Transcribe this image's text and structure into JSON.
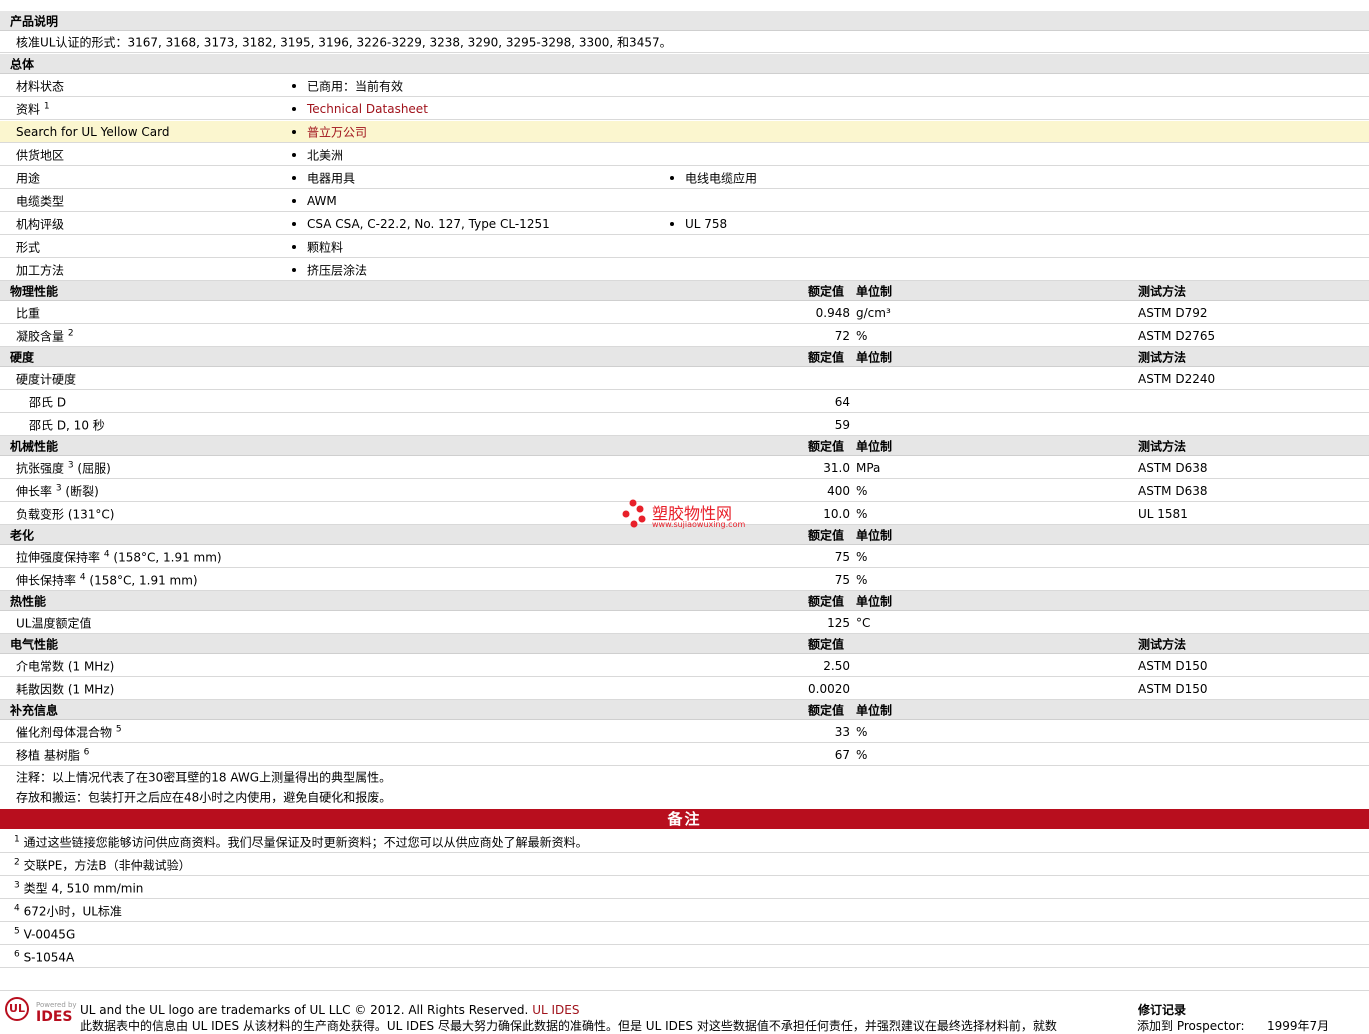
{
  "description": {
    "section": "产品说明",
    "text": "核准UL认证的形式：3167, 3168, 3173, 3182, 3195, 3196, 3226-3229, 3238, 3290, 3295-3298, 3300, 和3457。"
  },
  "general": {
    "section": "总体",
    "rows": [
      {
        "label": "材料状态",
        "sup": "",
        "values": [
          "已商用：当前有效"
        ]
      },
      {
        "label": "资料",
        "sup": "1",
        "values": [
          "Technical Datasheet"
        ]
      },
      {
        "label": "Search for UL Yellow Card",
        "sup": "",
        "values": [
          "普立万公司"
        ]
      },
      {
        "label": "供货地区",
        "sup": "",
        "values": [
          "北美洲"
        ]
      },
      {
        "label": "用途",
        "sup": "",
        "values": [
          "电器用具",
          "电线电缆应用"
        ]
      },
      {
        "label": "电缆类型",
        "sup": "",
        "values": [
          "AWM"
        ]
      },
      {
        "label": "机构评级",
        "sup": "",
        "values": [
          "CSA CSA, C-22.2, No. 127, Type CL-1251",
          "UL 758"
        ]
      },
      {
        "label": "形式",
        "sup": "",
        "values": [
          "颗粒料"
        ]
      },
      {
        "label": "加工方法",
        "sup": "",
        "values": [
          "挤压层涂法"
        ]
      }
    ]
  },
  "columns": {
    "nominal": "额定值",
    "unit": "单位制",
    "method": "测试方法"
  },
  "physical": {
    "section": "物理性能",
    "rows": [
      {
        "label": "比重",
        "sup": "",
        "cond": "",
        "value": "0.948",
        "unit": "g/cm³",
        "method": "ASTM D792"
      },
      {
        "label": "凝胶含量",
        "sup": "2",
        "cond": "",
        "value": "72",
        "unit": "%",
        "method": "ASTM D2765"
      }
    ]
  },
  "hardness": {
    "section": "硬度",
    "rows": [
      {
        "label": "硬度计硬度",
        "value": "",
        "method": "ASTM D2240"
      },
      {
        "label": "邵氏 D",
        "value": "64",
        "method": ""
      },
      {
        "label": "邵氏 D, 10 秒",
        "value": "59",
        "method": ""
      }
    ]
  },
  "mechanical": {
    "section": "机械性能",
    "rows": [
      {
        "label": "抗张强度",
        "sup": "3",
        "cond": "(屈服)",
        "value": "31.0",
        "unit": "MPa",
        "method": "ASTM D638"
      },
      {
        "label": "伸长率",
        "sup": "3",
        "cond": "(断裂)",
        "value": "400",
        "unit": "%",
        "method": "ASTM D638"
      },
      {
        "label": "负载变形 (131°C)",
        "sup": "",
        "cond": "",
        "value": "10.0",
        "unit": "%",
        "method": "UL 1581"
      }
    ]
  },
  "aging": {
    "section": "老化",
    "rows": [
      {
        "label": "拉伸强度保持率",
        "sup": "4",
        "cond": "(158°C, 1.91 mm)",
        "value": "75",
        "unit": "%"
      },
      {
        "label": "伸长保持率",
        "sup": "4",
        "cond": "(158°C, 1.91 mm)",
        "value": "75",
        "unit": "%"
      }
    ]
  },
  "thermal": {
    "section": "热性能",
    "rows": [
      {
        "label": "UL温度额定值",
        "value": "125",
        "unit": "°C"
      }
    ]
  },
  "electrical": {
    "section": "电气性能",
    "rows": [
      {
        "label": "介电常数 (1 MHz)",
        "value": "2.50",
        "method": "ASTM D150"
      },
      {
        "label": "耗散因数 (1 MHz)",
        "value": "0.0020",
        "method": "ASTM D150"
      }
    ]
  },
  "supplemental": {
    "section": "补充信息",
    "rows": [
      {
        "label": "催化剂母体混合物",
        "sup": "5",
        "value": "33",
        "unit": "%"
      },
      {
        "label": "移植 基树脂",
        "sup": "6",
        "value": "67",
        "unit": "%"
      }
    ]
  },
  "notes": [
    "注释：以上情况代表了在30密耳壁的18 AWG上测量得出的典型属性。",
    "存放和搬运：包装打开之后应在48小时之内使用，避免自硬化和报废。"
  ],
  "remarks": {
    "title": "备注",
    "items": [
      {
        "n": "1",
        "text": "通过这些链接您能够访问供应商资料。我们尽量保证及时更新资料；不过您可以从供应商处了解最新资料。"
      },
      {
        "n": "2",
        "text": "交联PE，方法B（非仲裁试验）"
      },
      {
        "n": "3",
        "text": "类型 4, 510 mm/min"
      },
      {
        "n": "4",
        "text": "672小时，UL标准"
      },
      {
        "n": "5",
        "text": "V-0045G"
      },
      {
        "n": "6",
        "text": "S-1054A"
      }
    ]
  },
  "watermark": {
    "name": "塑胶物性网",
    "url": "www.sujiaowuxing.com"
  },
  "footer": {
    "logo_text": "UL",
    "powered_by": "Powered by",
    "ides": "IDES",
    "trademark": "UL and the UL logo are trademarks of UL LLC © 2012. All Rights Reserved.",
    "trademark_link": "UL IDES",
    "disclaimer": "此数据表中的信息由 UL IDES 从该材料的生产商处获得。UL IDES 尽最大努力确保此数据的准确性。但是 UL IDES 对这些数据值不承担任何责任，并强烈建议在最终选择材料前，就数",
    "revision_title": "修订记录",
    "revision_text": "添加到 Prospector:",
    "revision_date": "1999年7月"
  },
  "colors": {
    "brand_red": "#b80e1e",
    "section_bg": "#e6e6e6",
    "highlight_bg": "#fbf6cf"
  }
}
